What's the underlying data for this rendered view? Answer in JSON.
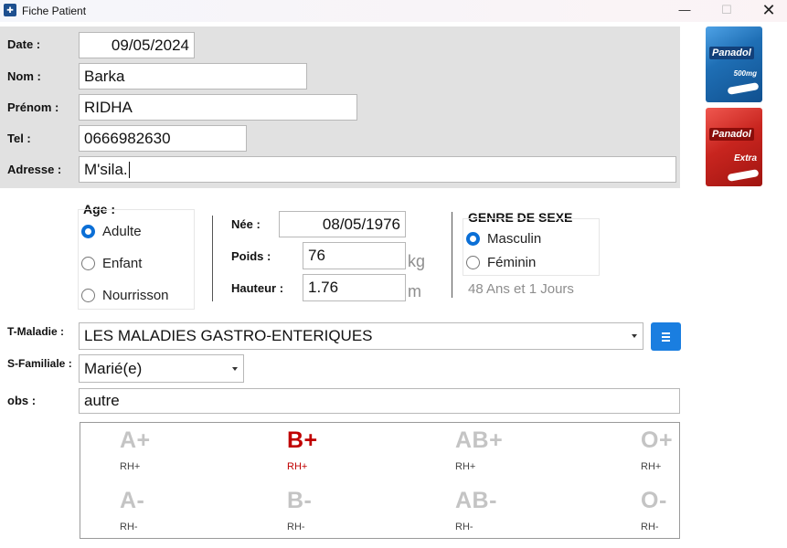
{
  "window": {
    "title": "Fiche Patient",
    "minimize": "—",
    "maximize": "☐",
    "close": "✕"
  },
  "form": {
    "date_label": "Date :",
    "date_value": "09/05/2024",
    "nom_label": "Nom :",
    "nom_value": "Barka",
    "prenom_label": "Prénom :",
    "prenom_value": "RIDHA",
    "tel_label": "Tel :",
    "tel_value": "0666982630",
    "adresse_label": "Adresse :",
    "adresse_value": "M'sila."
  },
  "age": {
    "title": "Age :",
    "options": [
      "Adulte",
      "Enfant",
      "Nourrisson"
    ],
    "selected": "Adulte"
  },
  "birth": {
    "nee_label": "Née :",
    "nee_value": "08/05/1976",
    "poids_label": "Poids :",
    "poids_value": "76",
    "poids_unit": "kg",
    "hauteur_label": "Hauteur :",
    "hauteur_value": "1.76",
    "hauteur_unit": "m"
  },
  "gender": {
    "title": "GENRE DE SEXE",
    "options": [
      "Masculin",
      "Féminin"
    ],
    "selected": "Masculin",
    "computed_age": "48 Ans et 1 Jours"
  },
  "maladie": {
    "label": "T-Maladie :",
    "value": "LES MALADIES GASTRO-ENTERIQUES"
  },
  "familiale": {
    "label": "S-Familiale :",
    "value": "Marié(e)"
  },
  "obs": {
    "label": "obs :",
    "value": "autre"
  },
  "blood": {
    "types": [
      {
        "group": "A+",
        "rh": "RH+"
      },
      {
        "group": "B+",
        "rh": "RH+"
      },
      {
        "group": "AB+",
        "rh": "RH+"
      },
      {
        "group": "O+",
        "rh": "RH+"
      },
      {
        "group": "A-",
        "rh": "RH-"
      },
      {
        "group": "B-",
        "rh": "RH-"
      },
      {
        "group": "AB-",
        "rh": "RH-"
      },
      {
        "group": "O-",
        "rh": "RH-"
      }
    ],
    "selected": "B+"
  },
  "products": [
    {
      "brand": "Panadol",
      "sub": "500mg",
      "color": "#1f6fb5"
    },
    {
      "brand": "Panadol",
      "sub": "Extra",
      "color": "#c8251f"
    }
  ],
  "colors": {
    "accent": "#0b6fd6",
    "selected_blood": "#c00000",
    "panel": "#e1e1e1"
  }
}
